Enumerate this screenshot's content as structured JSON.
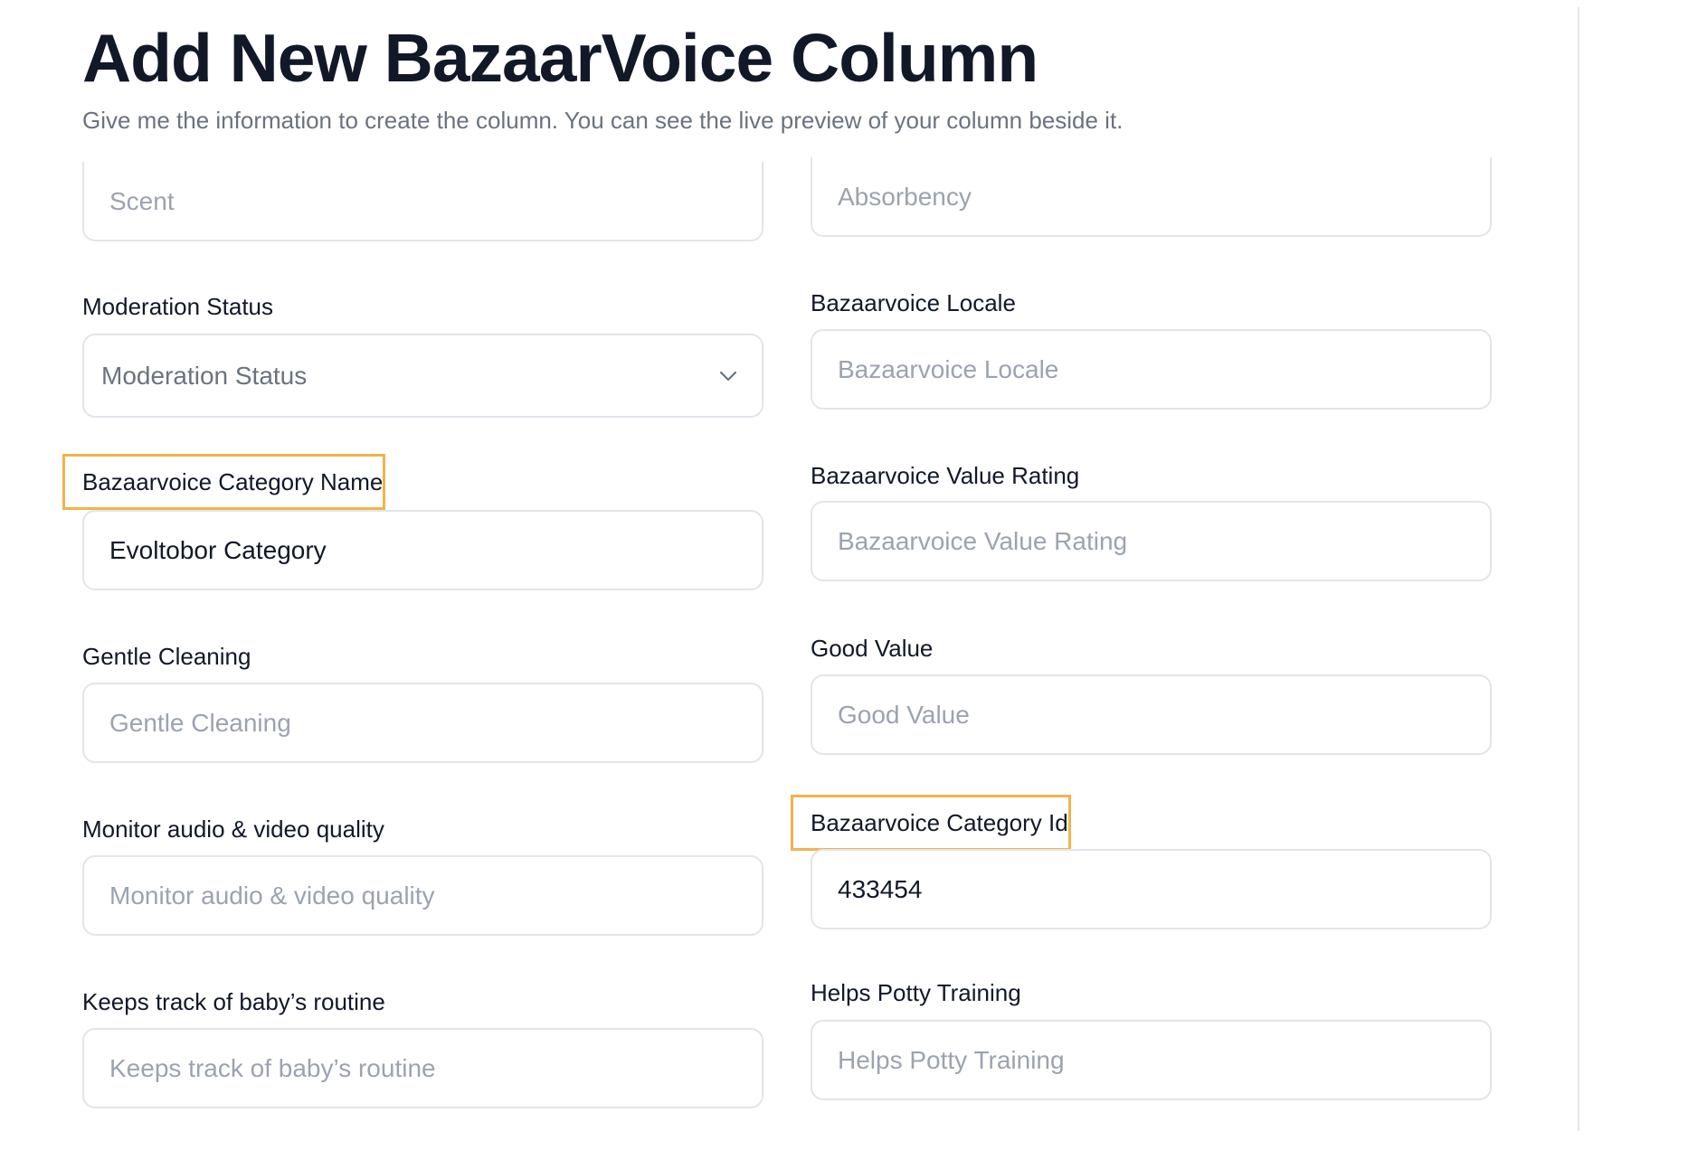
{
  "header": {
    "title": "Add New BazaarVoice Column",
    "subtitle": "Give me the information to create the column. You can see the live preview of your column beside it."
  },
  "left": {
    "scent": {
      "placeholder": "Scent",
      "value": ""
    },
    "moderation_status": {
      "label": "Moderation Status",
      "selected": "Moderation Status"
    },
    "category_name": {
      "label": "Bazaarvoice Category Name",
      "value": "Evoltobor Category"
    },
    "gentle_cleaning": {
      "label": "Gentle Cleaning",
      "placeholder": "Gentle Cleaning",
      "value": ""
    },
    "monitor_quality": {
      "label": "Monitor audio & video quality",
      "placeholder": "Monitor audio & video quality",
      "value": ""
    },
    "baby_routine": {
      "label": "Keeps track of baby’s routine",
      "placeholder": "Keeps track of baby’s routine",
      "value": ""
    }
  },
  "right": {
    "absorbency": {
      "placeholder": "Absorbency",
      "value": ""
    },
    "locale": {
      "label": "Bazaarvoice Locale",
      "placeholder": "Bazaarvoice Locale",
      "value": ""
    },
    "value_rating": {
      "label": "Bazaarvoice Value Rating",
      "placeholder": "Bazaarvoice Value Rating",
      "value": ""
    },
    "good_value": {
      "label": "Good Value",
      "placeholder": "Good Value",
      "value": ""
    },
    "category_id": {
      "label": "Bazaarvoice Category Id",
      "value": "433454"
    },
    "potty_training": {
      "label": "Helps Potty Training",
      "placeholder": "Helps Potty Training",
      "value": ""
    }
  },
  "icons": {
    "select_chevron": "chevron-down-icon"
  },
  "colors": {
    "highlight_border": "#f0b44c",
    "field_border": "#e2e5ea",
    "placeholder": "#9ca3af"
  }
}
